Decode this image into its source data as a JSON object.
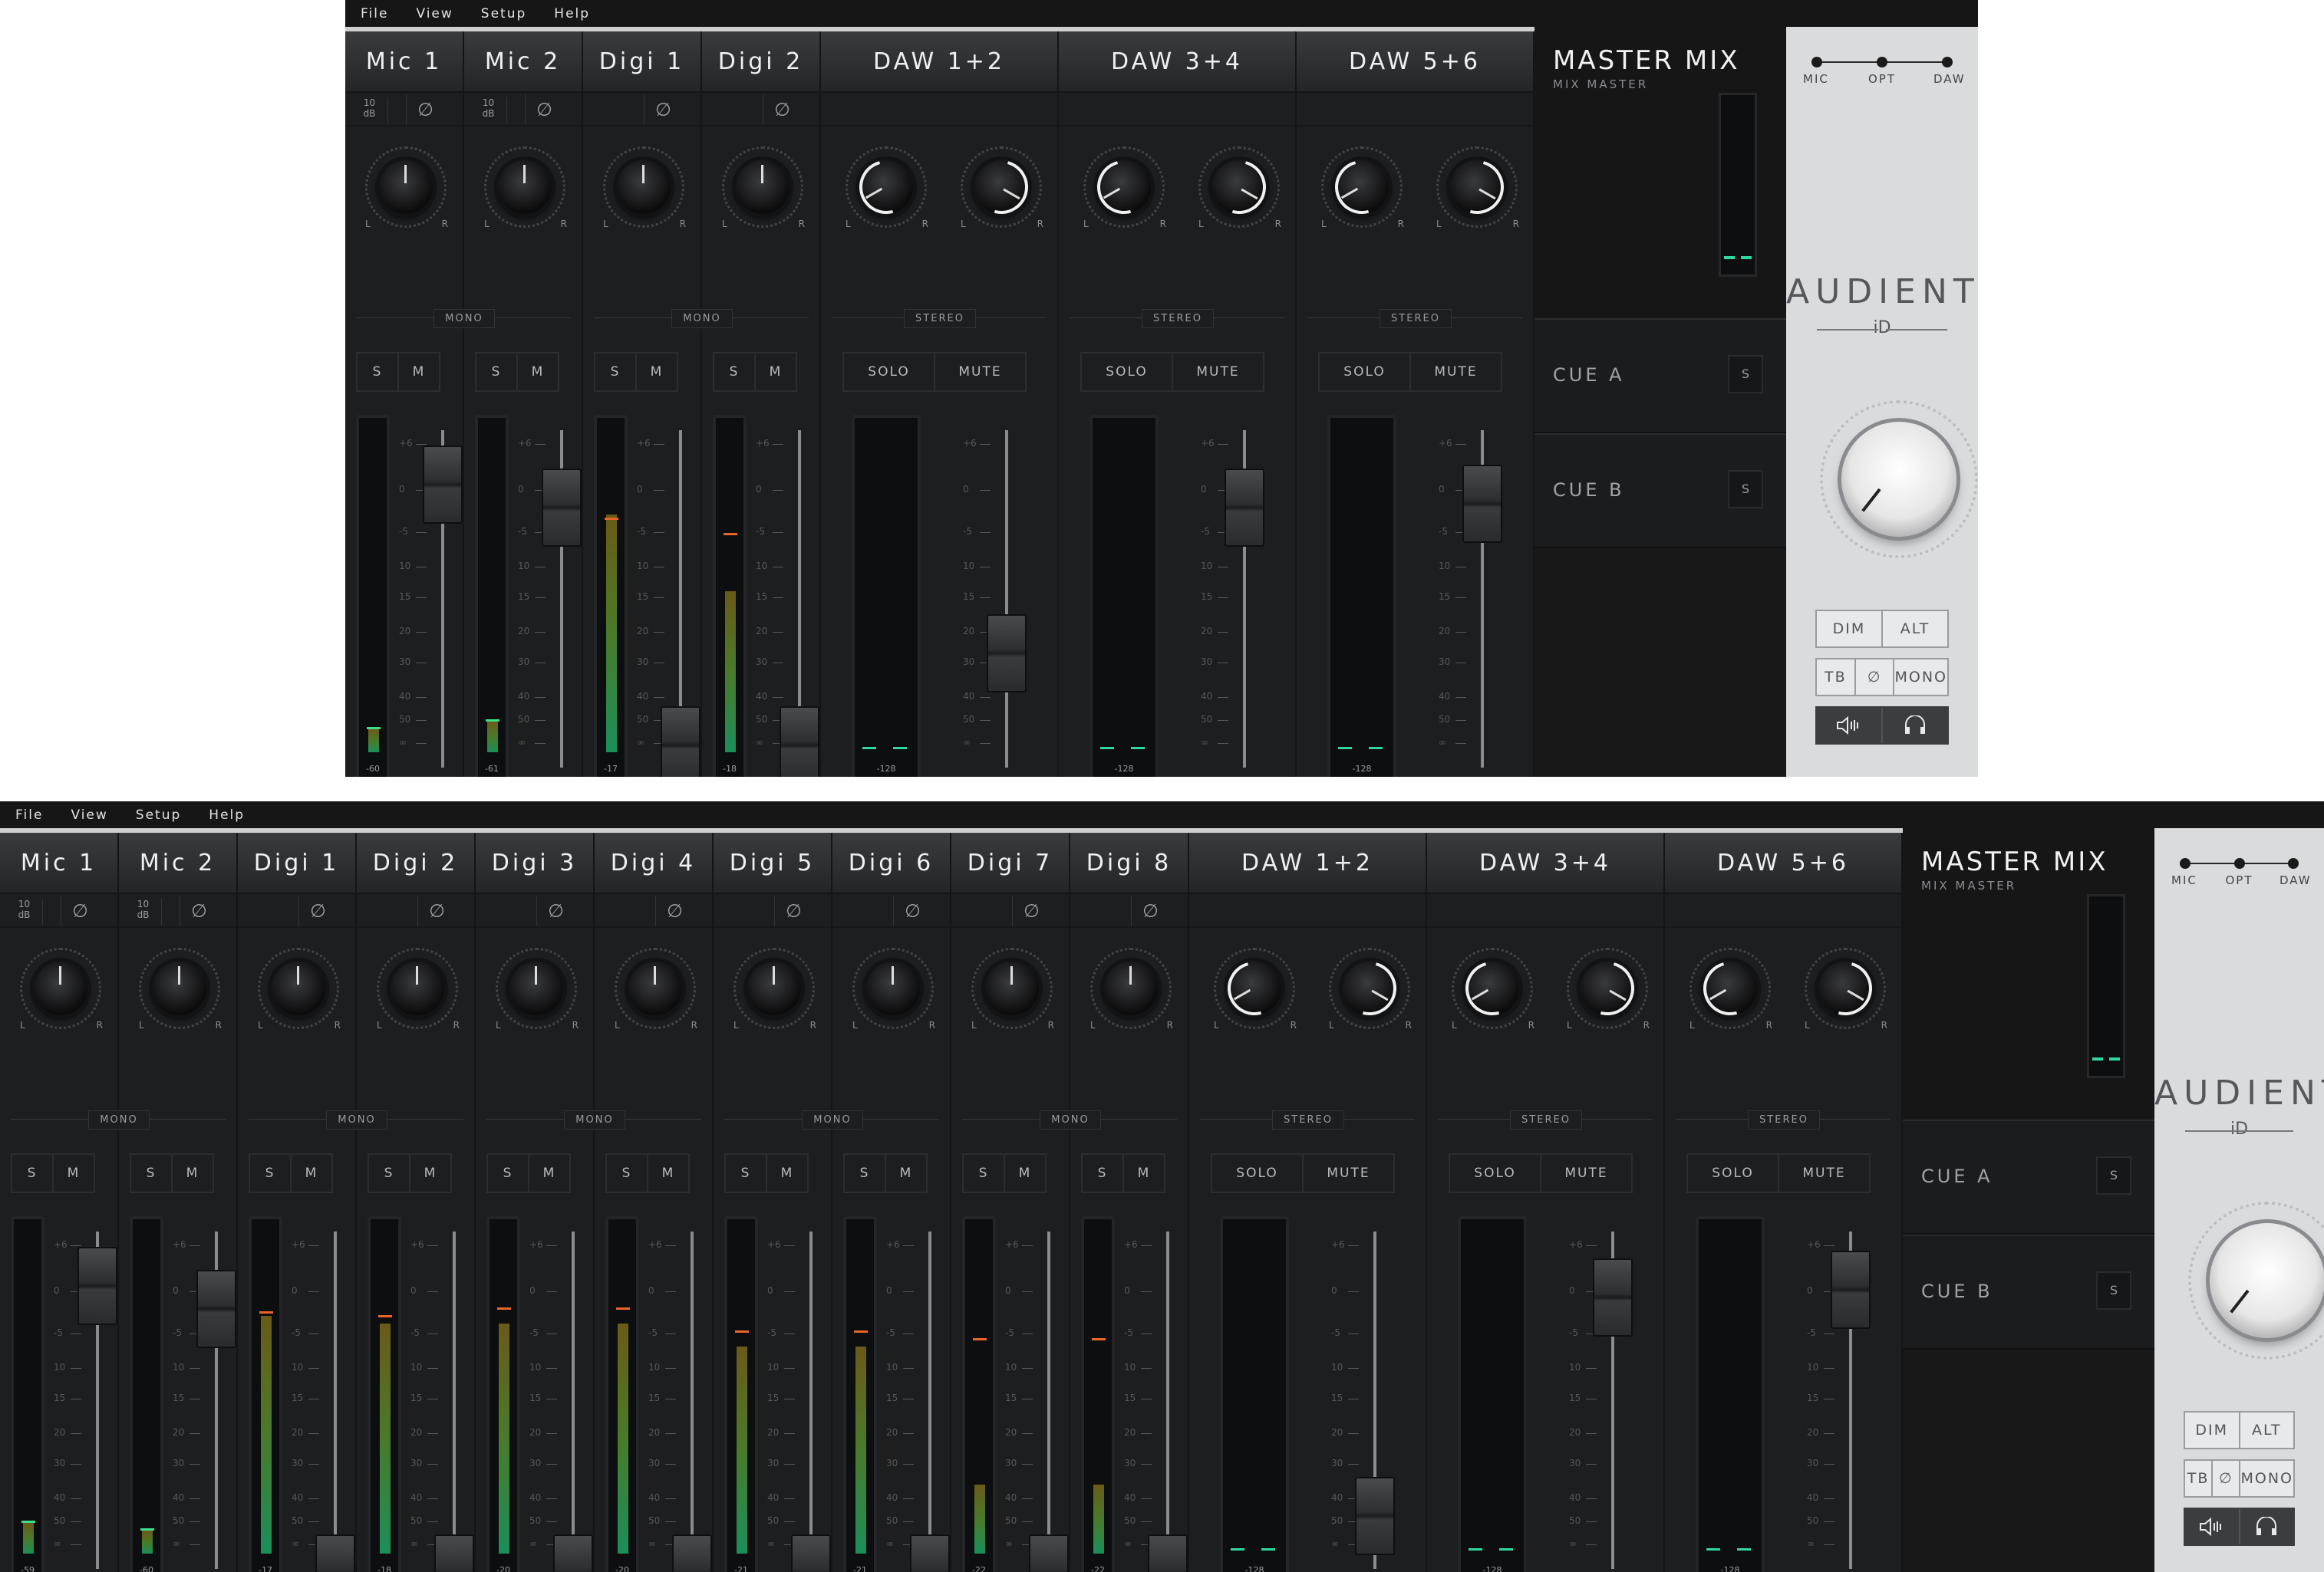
{
  "menu": [
    "File",
    "View",
    "Setup",
    "Help"
  ],
  "top_window": {
    "channels": [
      {
        "name": "Mic 1",
        "type": "mono",
        "gain": "10\ndB",
        "meter": "-60"
      },
      {
        "name": "Mic 2",
        "type": "mono",
        "gain": "10\ndB",
        "meter": "-61"
      },
      {
        "name": "Digi 1",
        "type": "mono",
        "gain": "",
        "meter": "-17"
      },
      {
        "name": "Digi 2",
        "type": "mono",
        "gain": "",
        "meter": "-18"
      },
      {
        "name": "DAW 1+2",
        "type": "stereo",
        "meter": "-128"
      },
      {
        "name": "DAW 3+4",
        "type": "stereo",
        "meter": "-128"
      },
      {
        "name": "DAW 5+6",
        "type": "stereo",
        "meter": "-128"
      }
    ]
  },
  "bottom_window": {
    "channels": [
      {
        "name": "Mic 1",
        "type": "mono",
        "gain": "10\ndB",
        "meter": "-59"
      },
      {
        "name": "Mic 2",
        "type": "mono",
        "gain": "10\ndB",
        "meter": "-60"
      },
      {
        "name": "Digi 1",
        "type": "mono",
        "gain": "",
        "meter": "-17"
      },
      {
        "name": "Digi 2",
        "type": "mono",
        "gain": "",
        "meter": "-18"
      },
      {
        "name": "Digi 3",
        "type": "mono",
        "gain": "",
        "meter": "-20"
      },
      {
        "name": "Digi 4",
        "type": "mono",
        "gain": "",
        "meter": "-20"
      },
      {
        "name": "Digi 5",
        "type": "mono",
        "gain": "",
        "meter": "-21"
      },
      {
        "name": "Digi 6",
        "type": "mono",
        "gain": "",
        "meter": "-21"
      },
      {
        "name": "Digi 7",
        "type": "mono",
        "gain": "",
        "meter": "-22"
      },
      {
        "name": "Digi 8",
        "type": "mono",
        "gain": "",
        "meter": "-22"
      },
      {
        "name": "DAW 1+2",
        "type": "stereo",
        "meter": "-128"
      },
      {
        "name": "DAW 3+4",
        "type": "stereo",
        "meter": "-128"
      },
      {
        "name": "DAW 5+6",
        "type": "stereo",
        "meter": "-128"
      }
    ]
  },
  "labels": {
    "pan_l": "L",
    "pan_r": "R",
    "mono": "MONO",
    "stereo": "STEREO",
    "solo_short": "S",
    "mute_short": "M",
    "solo": "SOLO",
    "mute": "MUTE",
    "phase": "∅",
    "scale": [
      "+6",
      "0",
      "-5",
      "10",
      "15",
      "20",
      "30",
      "40",
      "50",
      "∞"
    ]
  },
  "master": {
    "title": "MASTER MIX",
    "subtitle": "MIX MASTER",
    "cue_a": "CUE A",
    "cue_b": "CUE B",
    "cue_s": "S"
  },
  "panel": {
    "sources": [
      "MIC",
      "OPT",
      "DAW"
    ],
    "brand": "AUDIENT",
    "brand_sub": "iD",
    "dim": "DIM",
    "alt": "ALT",
    "tb": "TB",
    "phase": "∅",
    "mono": "MONO",
    "speaker_icon": "speaker-icon",
    "headphone_icon": "headphone-icon"
  },
  "colors": {
    "meter_green": "#1a8f5a",
    "peak_orange": "#e8642a",
    "cue_green": "#2fd8a0"
  }
}
